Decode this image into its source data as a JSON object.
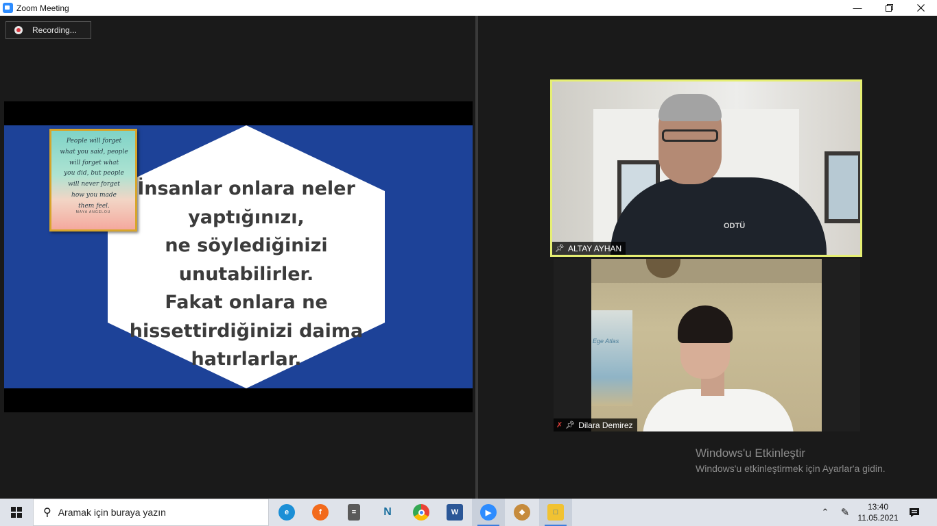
{
  "window": {
    "title": "Zoom Meeting",
    "minimize_icon": "minimize-icon",
    "maximize_icon": "restore-icon",
    "close_icon": "close-icon"
  },
  "recording": {
    "label": "Recording..."
  },
  "shared_slide": {
    "quote_lines": [
      "People will forget",
      "what you said, people",
      "will forget what",
      "you did, but people",
      "will never forget",
      "how you made",
      "them feel."
    ],
    "quote_author": "MAYA ANGELOU",
    "main_text_lines": [
      "İnsanlar onlara neler",
      "yaptığınızı,",
      "ne söylediğinizi",
      "unutabilirler.",
      "Fakat onlara ne",
      "hissettirdiğinizi daima",
      "hatırlarlar."
    ],
    "background_color": "#1d4298"
  },
  "participants": [
    {
      "name": "ALTAY AYHAN",
      "pinned": true,
      "muted": false,
      "active_speaker": true,
      "shirt_text": "ODTÜ"
    },
    {
      "name": "Dilara Demirez",
      "pinned": true,
      "muted": true,
      "active_speaker": false,
      "poster_text": "Ege Atlas"
    }
  ],
  "activation_watermark": {
    "title": "Windows'u Etkinleştir",
    "subtitle": "Windows'u etkinleştirmek için Ayarlar'a gidin."
  },
  "taskbar": {
    "search_placeholder": "Aramak için buraya yazın",
    "apps": [
      {
        "name": "edge-icon",
        "color": "#1b8fd6"
      },
      {
        "name": "firefox-icon",
        "color": "#f26a1b"
      },
      {
        "name": "calculator-icon",
        "color": "#5a5a5a"
      },
      {
        "name": "nx-icon",
        "color": "#1a6f9e"
      },
      {
        "name": "chrome-icon",
        "color": "#34a853"
      },
      {
        "name": "word-icon",
        "color": "#2b5797"
      },
      {
        "name": "zoom-icon",
        "color": "#2d8cff"
      },
      {
        "name": "paint-icon",
        "color": "#c68b3c"
      },
      {
        "name": "file-explorer-icon",
        "color": "#f1c232"
      }
    ],
    "time": "13:40",
    "date": "11.05.2021"
  }
}
